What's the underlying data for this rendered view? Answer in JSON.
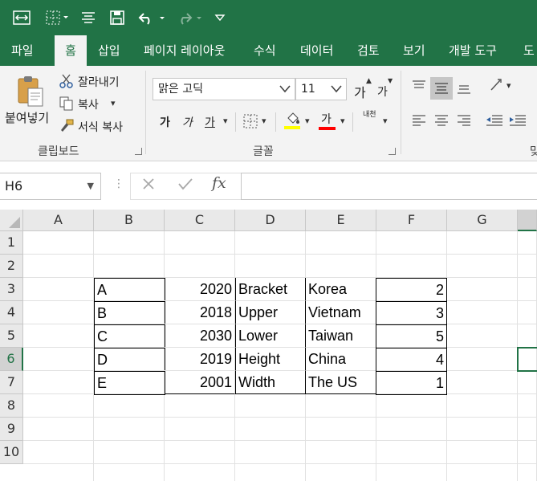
{
  "name_box": {
    "value": "H6"
  },
  "formula": {
    "fx_label": "fx",
    "value": ""
  },
  "tabs": [
    "파일",
    "홈",
    "삽입",
    "페이지 레이아웃",
    "수식",
    "데이터",
    "검토",
    "보기",
    "개발 도구",
    "도"
  ],
  "clipboard": {
    "paste": "붙여넣기",
    "cut": "잘라내기",
    "copy": "복사",
    "format_painter": "서식 복사",
    "group_label": "클립보드"
  },
  "font": {
    "name": "맑은 고딕",
    "size": "11",
    "grow": "가",
    "shrink": "가",
    "bold": "가",
    "italic": "가",
    "underline": "가",
    "font_color_letter": "가",
    "phonetic": "내천",
    "group_label": "글꼴"
  },
  "align_group_label_partial": "맞",
  "columns": [
    "A",
    "B",
    "C",
    "D",
    "E",
    "F",
    "G"
  ],
  "rows": [
    "1",
    "2",
    "3",
    "4",
    "5",
    "6",
    "7",
    "8",
    "9",
    "10"
  ],
  "table": [
    {
      "b": "A",
      "c": "2020",
      "d": "Bracket",
      "e": "Korea",
      "f": "2"
    },
    {
      "b": "B",
      "c": "2018",
      "d": "Upper",
      "e": "Vietnam",
      "f": "3"
    },
    {
      "b": "C",
      "c": "2030",
      "d": "Lower",
      "e": "Taiwan",
      "f": "5"
    },
    {
      "b": "D",
      "c": "2019",
      "d": "Height",
      "e": "China",
      "f": "4"
    },
    {
      "b": "E",
      "c": "2001",
      "d": "Width",
      "e": "The US",
      "f": "1"
    }
  ],
  "colors": {
    "brand": "#217346",
    "fill_swatch": "#ffff00",
    "font_swatch": "#ff0000"
  }
}
